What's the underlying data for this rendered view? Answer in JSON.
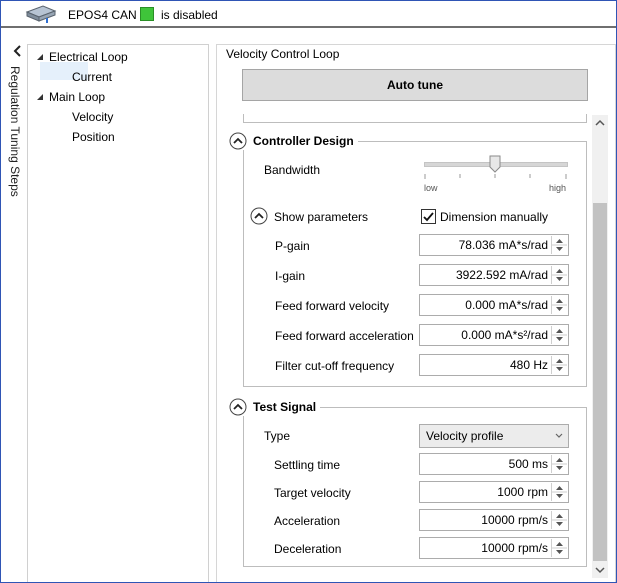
{
  "header": {
    "device_name": "EPOS4 CAN",
    "state_text": "is disabled",
    "status_color": "#3fc43a"
  },
  "sidebar": {
    "vertical_title": "Regulation Tuning Steps"
  },
  "tree": {
    "electrical_loop": "Electrical Loop",
    "current": "Current",
    "main_loop": "Main Loop",
    "velocity": "Velocity",
    "position": "Position"
  },
  "panel": {
    "title": "Velocity Control Loop",
    "auto_tune_label": "Auto tune"
  },
  "controller_design": {
    "title": "Controller Design",
    "bandwidth_label": "Bandwidth",
    "slider_low": "low",
    "slider_high": "high",
    "slider_level": 0.5,
    "show_parameters": "Show parameters",
    "dimension_manually": "Dimension manually",
    "dimension_checked": true,
    "params": {
      "p_gain_label": "P-gain",
      "p_gain_value": "78.036 mA*s/rad",
      "i_gain_label": "I-gain",
      "i_gain_value": "3922.592 mA/rad",
      "ff_vel_label": "Feed forward velocity",
      "ff_vel_value": "0.000 mA*s/rad",
      "ff_acc_label": "Feed forward acceleration",
      "ff_acc_value": "0.000 mA*s²/rad",
      "filter_label": "Filter cut-off frequency",
      "filter_value": "480 Hz"
    }
  },
  "test_signal": {
    "title": "Test Signal",
    "type_label": "Type",
    "type_value": "Velocity profile",
    "settling_label": "Settling time",
    "settling_value": "500 ms",
    "target_vel_label": "Target velocity",
    "target_vel_value": "1000 rpm",
    "accel_label": "Acceleration",
    "accel_value": "10000 rpm/s",
    "decel_label": "Deceleration",
    "decel_value": "10000 rpm/s"
  }
}
